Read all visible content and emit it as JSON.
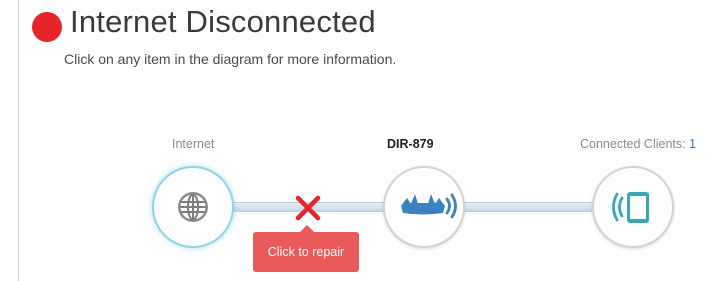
{
  "header": {
    "status_color": "#e8242b",
    "title": "Internet Disconnected",
    "subtitle": "Click on any item in the diagram for more information."
  },
  "diagram": {
    "internet": {
      "label": "Internet",
      "icon": "globe-icon"
    },
    "router": {
      "label": "DIR-879",
      "icon": "router-icon"
    },
    "clients": {
      "label": "Connected Clients: ",
      "count": "1",
      "icon": "tablet-wireless-icon"
    },
    "error": {
      "icon": "red-x-icon",
      "color": "#e8242b"
    },
    "repair_tooltip": {
      "label": "Click to repair",
      "color": "#ea5a5a"
    }
  }
}
